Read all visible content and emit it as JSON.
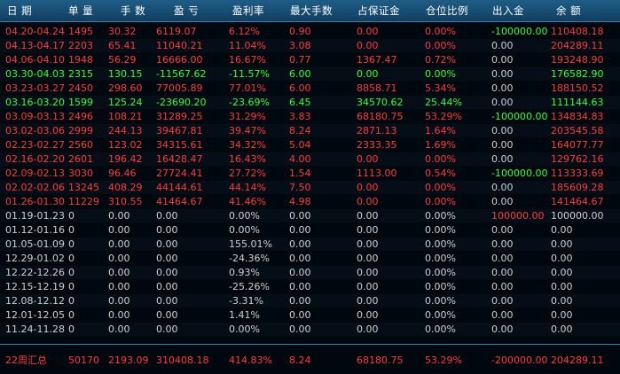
{
  "columns": [
    "日 期",
    "单 量",
    "手 数",
    "盈 亏",
    "盈利率",
    "最大手数",
    "占保证金",
    "仓位比例",
    "出入金",
    "余 额"
  ],
  "rows": [
    {
      "date": "04.20-04.24",
      "count": "1495",
      "lots": "30.32",
      "pnl": "6119.07",
      "rate": "6.12%",
      "max_lots": "0.90",
      "margin": "0.00",
      "ratio": "0.00%",
      "flow": "-100000.00",
      "balance": "110408.18",
      "color": "red",
      "flow_color": "green"
    },
    {
      "date": "04.13-04.17",
      "count": "2203",
      "lots": "65.41",
      "pnl": "11040.21",
      "rate": "11.04%",
      "max_lots": "3.08",
      "margin": "0.00",
      "ratio": "0.00%",
      "flow": "0.00",
      "balance": "204289.11",
      "color": "red",
      "flow_color": "white"
    },
    {
      "date": "04.06-04.10",
      "count": "1948",
      "lots": "56.29",
      "pnl": "16666.00",
      "rate": "16.67%",
      "max_lots": "0.77",
      "margin": "1367.47",
      "ratio": "0.72%",
      "flow": "0.00",
      "balance": "193248.90",
      "color": "red",
      "flow_color": "white"
    },
    {
      "date": "03.30-04.03",
      "count": "2315",
      "lots": "130.15",
      "pnl": "-11567.62",
      "rate": "-11.57%",
      "max_lots": "6.00",
      "margin": "0.00",
      "ratio": "0.00%",
      "flow": "0.00",
      "balance": "176582.90",
      "color": "green",
      "flow_color": "white"
    },
    {
      "date": "03.23-03.27",
      "count": "2450",
      "lots": "298.60",
      "pnl": "77005.89",
      "rate": "77.01%",
      "max_lots": "6.00",
      "margin": "8858.71",
      "ratio": "5.34%",
      "flow": "0.00",
      "balance": "188150.52",
      "color": "red",
      "flow_color": "white"
    },
    {
      "date": "03.16-03.20",
      "count": "1599",
      "lots": "125.24",
      "pnl": "-23690.20",
      "rate": "-23.69%",
      "max_lots": "6.45",
      "margin": "34570.62",
      "ratio": "25.44%",
      "flow": "0.00",
      "balance": "111144.63",
      "color": "green",
      "flow_color": "white"
    },
    {
      "date": "03.09-03.13",
      "count": "2496",
      "lots": "108.21",
      "pnl": "31289.25",
      "rate": "31.29%",
      "max_lots": "3.83",
      "margin": "68180.75",
      "ratio": "53.29%",
      "flow": "-100000.00",
      "balance": "134834.83",
      "color": "red",
      "flow_color": "green"
    },
    {
      "date": "03.02-03.06",
      "count": "2999",
      "lots": "244.13",
      "pnl": "39467.81",
      "rate": "39.47%",
      "max_lots": "8.24",
      "margin": "2871.13",
      "ratio": "1.64%",
      "flow": "0.00",
      "balance": "203545.58",
      "color": "red",
      "flow_color": "white"
    },
    {
      "date": "02.23-02.27",
      "count": "2560",
      "lots": "123.02",
      "pnl": "34315.61",
      "rate": "34.32%",
      "max_lots": "5.04",
      "margin": "2333.35",
      "ratio": "1.69%",
      "flow": "0.00",
      "balance": "164077.77",
      "color": "red",
      "flow_color": "white"
    },
    {
      "date": "02.16-02.20",
      "count": "2601",
      "lots": "196.42",
      "pnl": "16428.47",
      "rate": "16.43%",
      "max_lots": "4.00",
      "margin": "0.00",
      "ratio": "0.00%",
      "flow": "0.00",
      "balance": "129762.16",
      "color": "red",
      "flow_color": "white"
    },
    {
      "date": "02.09-02.13",
      "count": "3030",
      "lots": "96.46",
      "pnl": "27724.41",
      "rate": "27.72%",
      "max_lots": "1.54",
      "margin": "1113.00",
      "ratio": "0.54%",
      "flow": "-100000.00",
      "balance": "113333.69",
      "color": "red",
      "flow_color": "green"
    },
    {
      "date": "02.02-02.06",
      "count": "13245",
      "lots": "408.29",
      "pnl": "44144.61",
      "rate": "44.14%",
      "max_lots": "7.50",
      "margin": "0.00",
      "ratio": "0.00%",
      "flow": "0.00",
      "balance": "185609.28",
      "color": "red",
      "flow_color": "white"
    },
    {
      "date": "01.26-01.30",
      "count": "11229",
      "lots": "310.55",
      "pnl": "41464.67",
      "rate": "41.46%",
      "max_lots": "4.98",
      "margin": "0.00",
      "ratio": "0.00%",
      "flow": "0.00",
      "balance": "141464.67",
      "color": "red",
      "flow_color": "white"
    },
    {
      "date": "01.19-01.23",
      "count": "0",
      "lots": "0.00",
      "pnl": "0.00",
      "rate": "0.00%",
      "max_lots": "0.00",
      "margin": "0.00",
      "ratio": "0.00%",
      "flow": "100000.00",
      "balance": "100000.00",
      "color": "white",
      "flow_color": "red"
    },
    {
      "date": "01.12-01.16",
      "count": "0",
      "lots": "0.00",
      "pnl": "0.00",
      "rate": "0.00%",
      "max_lots": "0.00",
      "margin": "0.00",
      "ratio": "0.00%",
      "flow": "0.00",
      "balance": "0.00",
      "color": "white",
      "flow_color": "white"
    },
    {
      "date": "01.05-01.09",
      "count": "0",
      "lots": "0.00",
      "pnl": "0.00",
      "rate": "155.01%",
      "max_lots": "0.00",
      "margin": "0.00",
      "ratio": "0.00%",
      "flow": "0.00",
      "balance": "0.00",
      "color": "white",
      "flow_color": "white"
    },
    {
      "date": "12.29-01.02",
      "count": "0",
      "lots": "0.00",
      "pnl": "0.00",
      "rate": "-24.36%",
      "max_lots": "0.00",
      "margin": "0.00",
      "ratio": "0.00%",
      "flow": "0.00",
      "balance": "0.00",
      "color": "white",
      "flow_color": "white"
    },
    {
      "date": "12.22-12.26",
      "count": "0",
      "lots": "0.00",
      "pnl": "0.00",
      "rate": "0.93%",
      "max_lots": "0.00",
      "margin": "0.00",
      "ratio": "0.00%",
      "flow": "0.00",
      "balance": "0.00",
      "color": "white",
      "flow_color": "white"
    },
    {
      "date": "12.15-12.19",
      "count": "0",
      "lots": "0.00",
      "pnl": "0.00",
      "rate": "-25.26%",
      "max_lots": "0.00",
      "margin": "0.00",
      "ratio": "0.00%",
      "flow": "0.00",
      "balance": "0.00",
      "color": "white",
      "flow_color": "white"
    },
    {
      "date": "12.08-12.12",
      "count": "0",
      "lots": "0.00",
      "pnl": "0.00",
      "rate": "-3.31%",
      "max_lots": "0.00",
      "margin": "0.00",
      "ratio": "0.00%",
      "flow": "0.00",
      "balance": "0.00",
      "color": "white",
      "flow_color": "white"
    },
    {
      "date": "12.01-12.05",
      "count": "0",
      "lots": "0.00",
      "pnl": "0.00",
      "rate": "1.41%",
      "max_lots": "0.00",
      "margin": "0.00",
      "ratio": "0.00%",
      "flow": "0.00",
      "balance": "0.00",
      "color": "white",
      "flow_color": "white"
    },
    {
      "date": "11.24-11.28",
      "count": "0",
      "lots": "0.00",
      "pnl": "0.00",
      "rate": "0.00%",
      "max_lots": "0.00",
      "margin": "0.00",
      "ratio": "0.00%",
      "flow": "0.00",
      "balance": "0.00",
      "color": "white",
      "flow_color": "white"
    }
  ],
  "summary": {
    "date": "22周汇总",
    "count": "50170",
    "lots": "2193.09",
    "pnl": "310408.18",
    "rate": "414.83%",
    "max_lots": "8.24",
    "margin": "68180.75",
    "ratio": "53.29%",
    "flow": "-200000.00",
    "balance": "204289.11"
  },
  "colors": {
    "red": "#ff3b3b",
    "green": "#33ff33",
    "white": "#cfcfcf",
    "header_bg": "#1a5075",
    "background": "#00080f"
  }
}
